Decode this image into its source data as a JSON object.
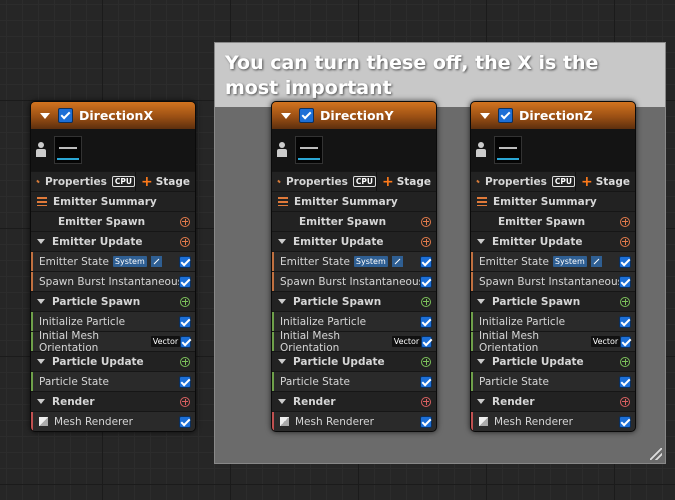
{
  "comment": {
    "text": "You can turn these off, the X is the most important"
  },
  "labels": {
    "properties": "Properties",
    "cpu": "CPU",
    "stage": "Stage",
    "emitter_summary": "Emitter Summary",
    "emitter_spawn": "Emitter Spawn",
    "emitter_update": "Emitter Update",
    "emitter_state": "Emitter State",
    "system_tag": "System",
    "spawn_burst": "Spawn Burst Instantaneous",
    "particle_spawn": "Particle Spawn",
    "initialize_particle": "Initialize Particle",
    "initial_mesh_orientation": "Initial Mesh Orientation",
    "vector_tag": "Vector",
    "particle_update": "Particle Update",
    "particle_state": "Particle State",
    "render": "Render",
    "mesh_renderer": "Mesh Renderer"
  },
  "nodes": [
    {
      "title": "DirectionX"
    },
    {
      "title": "DirectionY"
    },
    {
      "title": "DirectionZ"
    }
  ],
  "colors": {
    "header_orange": "#c8651c",
    "check_blue": "#1d6fd6",
    "comment_bg": "#6b6b6b",
    "comment_header": "#c8c8c8"
  }
}
